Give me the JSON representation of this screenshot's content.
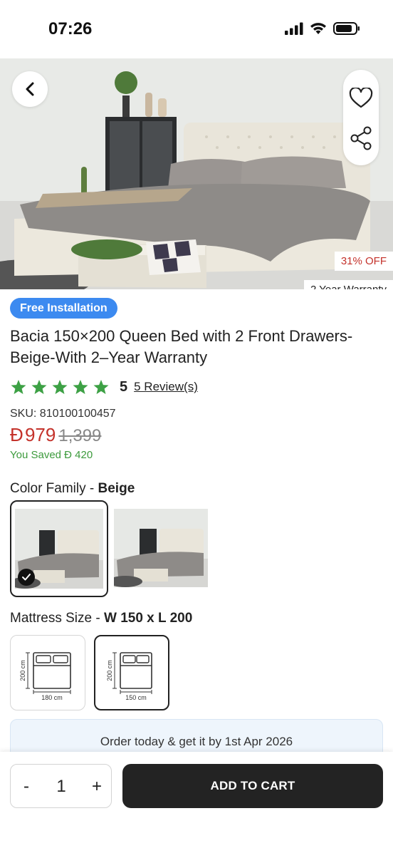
{
  "status_bar": {
    "time": "07:26"
  },
  "hero": {
    "discount_tag": "31% OFF",
    "warranty_tag": "2 Year Warranty"
  },
  "product": {
    "badge": "Free Installation",
    "title": "Bacia 150×200 Queen Bed with 2 Front Drawers-Beige-With 2–Year Warranty",
    "rating_value": "5",
    "rating_stars": 5,
    "reviews_link": "5 Review(s)",
    "sku": "SKU: 810100100457",
    "currency_symbol": "Đ",
    "price": "979",
    "old_price": "1,399",
    "saved_text": "You Saved Đ 420"
  },
  "color_family": {
    "label": "Color Family - ",
    "selected": "Beige",
    "options_count": 2,
    "selected_index": 0
  },
  "mattress_size": {
    "label": "Mattress Size - ",
    "selected": "W 150 x L 200",
    "options": [
      {
        "length": "200 cm",
        "width": "180 cm"
      },
      {
        "length": "200 cm",
        "width": "150 cm"
      }
    ],
    "selected_index": 1
  },
  "delivery": {
    "text": "Order today & get it by 1st Apr 2026"
  },
  "bottom_bar": {
    "qty_minus": "-",
    "quantity": "1",
    "qty_plus": "+",
    "add_to_cart": "ADD TO CART"
  },
  "colors": {
    "accent_blue": "#3c8af0",
    "price_red": "#c4322b",
    "saved_green": "#3c9a3c",
    "star_green": "#3da145",
    "cart_button": "#232323"
  },
  "icons": [
    "back-chevron-icon",
    "heart-icon",
    "share-icon",
    "star-icon",
    "check-icon",
    "signal-icon",
    "wifi-icon",
    "battery-icon",
    "bed-size-icon"
  ]
}
